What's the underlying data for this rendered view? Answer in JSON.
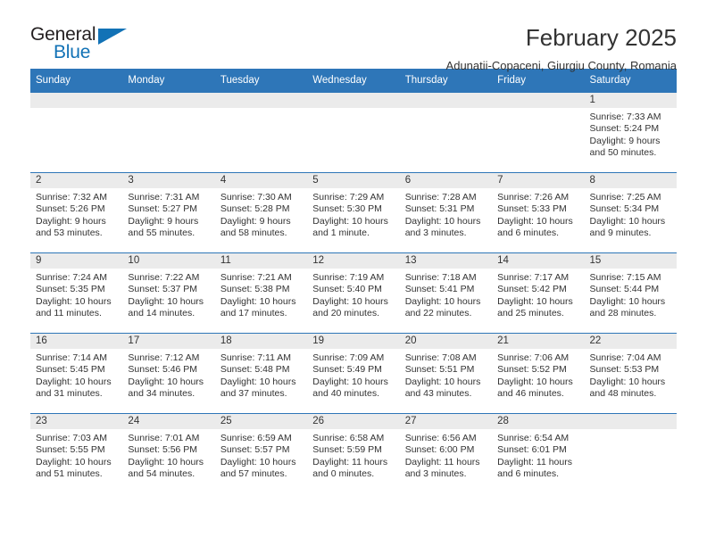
{
  "brand": {
    "word_one": "General",
    "word_two": "Blue",
    "accent_color": "#1272b6",
    "dark_color": "#231f20"
  },
  "header": {
    "title": "February 2025",
    "subtitle": "Adunatii-Copaceni, Giurgiu County, Romania",
    "header_bg": "#2e76b8",
    "daynum_bg": "#ebebeb"
  },
  "weekday_headers": [
    "Sunday",
    "Monday",
    "Tuesday",
    "Wednesday",
    "Thursday",
    "Friday",
    "Saturday"
  ],
  "weeks": [
    [
      {
        "day": "",
        "sunrise": "",
        "sunset": "",
        "daylight_line1": "",
        "daylight_line2": ""
      },
      {
        "day": "",
        "sunrise": "",
        "sunset": "",
        "daylight_line1": "",
        "daylight_line2": ""
      },
      {
        "day": "",
        "sunrise": "",
        "sunset": "",
        "daylight_line1": "",
        "daylight_line2": ""
      },
      {
        "day": "",
        "sunrise": "",
        "sunset": "",
        "daylight_line1": "",
        "daylight_line2": ""
      },
      {
        "day": "",
        "sunrise": "",
        "sunset": "",
        "daylight_line1": "",
        "daylight_line2": ""
      },
      {
        "day": "",
        "sunrise": "",
        "sunset": "",
        "daylight_line1": "",
        "daylight_line2": ""
      },
      {
        "day": "1",
        "sunrise": "Sunrise: 7:33 AM",
        "sunset": "Sunset: 5:24 PM",
        "daylight_line1": "Daylight: 9 hours",
        "daylight_line2": "and 50 minutes."
      }
    ],
    [
      {
        "day": "2",
        "sunrise": "Sunrise: 7:32 AM",
        "sunset": "Sunset: 5:26 PM",
        "daylight_line1": "Daylight: 9 hours",
        "daylight_line2": "and 53 minutes."
      },
      {
        "day": "3",
        "sunrise": "Sunrise: 7:31 AM",
        "sunset": "Sunset: 5:27 PM",
        "daylight_line1": "Daylight: 9 hours",
        "daylight_line2": "and 55 minutes."
      },
      {
        "day": "4",
        "sunrise": "Sunrise: 7:30 AM",
        "sunset": "Sunset: 5:28 PM",
        "daylight_line1": "Daylight: 9 hours",
        "daylight_line2": "and 58 minutes."
      },
      {
        "day": "5",
        "sunrise": "Sunrise: 7:29 AM",
        "sunset": "Sunset: 5:30 PM",
        "daylight_line1": "Daylight: 10 hours",
        "daylight_line2": "and 1 minute."
      },
      {
        "day": "6",
        "sunrise": "Sunrise: 7:28 AM",
        "sunset": "Sunset: 5:31 PM",
        "daylight_line1": "Daylight: 10 hours",
        "daylight_line2": "and 3 minutes."
      },
      {
        "day": "7",
        "sunrise": "Sunrise: 7:26 AM",
        "sunset": "Sunset: 5:33 PM",
        "daylight_line1": "Daylight: 10 hours",
        "daylight_line2": "and 6 minutes."
      },
      {
        "day": "8",
        "sunrise": "Sunrise: 7:25 AM",
        "sunset": "Sunset: 5:34 PM",
        "daylight_line1": "Daylight: 10 hours",
        "daylight_line2": "and 9 minutes."
      }
    ],
    [
      {
        "day": "9",
        "sunrise": "Sunrise: 7:24 AM",
        "sunset": "Sunset: 5:35 PM",
        "daylight_line1": "Daylight: 10 hours",
        "daylight_line2": "and 11 minutes."
      },
      {
        "day": "10",
        "sunrise": "Sunrise: 7:22 AM",
        "sunset": "Sunset: 5:37 PM",
        "daylight_line1": "Daylight: 10 hours",
        "daylight_line2": "and 14 minutes."
      },
      {
        "day": "11",
        "sunrise": "Sunrise: 7:21 AM",
        "sunset": "Sunset: 5:38 PM",
        "daylight_line1": "Daylight: 10 hours",
        "daylight_line2": "and 17 minutes."
      },
      {
        "day": "12",
        "sunrise": "Sunrise: 7:19 AM",
        "sunset": "Sunset: 5:40 PM",
        "daylight_line1": "Daylight: 10 hours",
        "daylight_line2": "and 20 minutes."
      },
      {
        "day": "13",
        "sunrise": "Sunrise: 7:18 AM",
        "sunset": "Sunset: 5:41 PM",
        "daylight_line1": "Daylight: 10 hours",
        "daylight_line2": "and 22 minutes."
      },
      {
        "day": "14",
        "sunrise": "Sunrise: 7:17 AM",
        "sunset": "Sunset: 5:42 PM",
        "daylight_line1": "Daylight: 10 hours",
        "daylight_line2": "and 25 minutes."
      },
      {
        "day": "15",
        "sunrise": "Sunrise: 7:15 AM",
        "sunset": "Sunset: 5:44 PM",
        "daylight_line1": "Daylight: 10 hours",
        "daylight_line2": "and 28 minutes."
      }
    ],
    [
      {
        "day": "16",
        "sunrise": "Sunrise: 7:14 AM",
        "sunset": "Sunset: 5:45 PM",
        "daylight_line1": "Daylight: 10 hours",
        "daylight_line2": "and 31 minutes."
      },
      {
        "day": "17",
        "sunrise": "Sunrise: 7:12 AM",
        "sunset": "Sunset: 5:46 PM",
        "daylight_line1": "Daylight: 10 hours",
        "daylight_line2": "and 34 minutes."
      },
      {
        "day": "18",
        "sunrise": "Sunrise: 7:11 AM",
        "sunset": "Sunset: 5:48 PM",
        "daylight_line1": "Daylight: 10 hours",
        "daylight_line2": "and 37 minutes."
      },
      {
        "day": "19",
        "sunrise": "Sunrise: 7:09 AM",
        "sunset": "Sunset: 5:49 PM",
        "daylight_line1": "Daylight: 10 hours",
        "daylight_line2": "and 40 minutes."
      },
      {
        "day": "20",
        "sunrise": "Sunrise: 7:08 AM",
        "sunset": "Sunset: 5:51 PM",
        "daylight_line1": "Daylight: 10 hours",
        "daylight_line2": "and 43 minutes."
      },
      {
        "day": "21",
        "sunrise": "Sunrise: 7:06 AM",
        "sunset": "Sunset: 5:52 PM",
        "daylight_line1": "Daylight: 10 hours",
        "daylight_line2": "and 46 minutes."
      },
      {
        "day": "22",
        "sunrise": "Sunrise: 7:04 AM",
        "sunset": "Sunset: 5:53 PM",
        "daylight_line1": "Daylight: 10 hours",
        "daylight_line2": "and 48 minutes."
      }
    ],
    [
      {
        "day": "23",
        "sunrise": "Sunrise: 7:03 AM",
        "sunset": "Sunset: 5:55 PM",
        "daylight_line1": "Daylight: 10 hours",
        "daylight_line2": "and 51 minutes."
      },
      {
        "day": "24",
        "sunrise": "Sunrise: 7:01 AM",
        "sunset": "Sunset: 5:56 PM",
        "daylight_line1": "Daylight: 10 hours",
        "daylight_line2": "and 54 minutes."
      },
      {
        "day": "25",
        "sunrise": "Sunrise: 6:59 AM",
        "sunset": "Sunset: 5:57 PM",
        "daylight_line1": "Daylight: 10 hours",
        "daylight_line2": "and 57 minutes."
      },
      {
        "day": "26",
        "sunrise": "Sunrise: 6:58 AM",
        "sunset": "Sunset: 5:59 PM",
        "daylight_line1": "Daylight: 11 hours",
        "daylight_line2": "and 0 minutes."
      },
      {
        "day": "27",
        "sunrise": "Sunrise: 6:56 AM",
        "sunset": "Sunset: 6:00 PM",
        "daylight_line1": "Daylight: 11 hours",
        "daylight_line2": "and 3 minutes."
      },
      {
        "day": "28",
        "sunrise": "Sunrise: 6:54 AM",
        "sunset": "Sunset: 6:01 PM",
        "daylight_line1": "Daylight: 11 hours",
        "daylight_line2": "and 6 minutes."
      },
      {
        "day": "",
        "sunrise": "",
        "sunset": "",
        "daylight_line1": "",
        "daylight_line2": ""
      }
    ]
  ]
}
